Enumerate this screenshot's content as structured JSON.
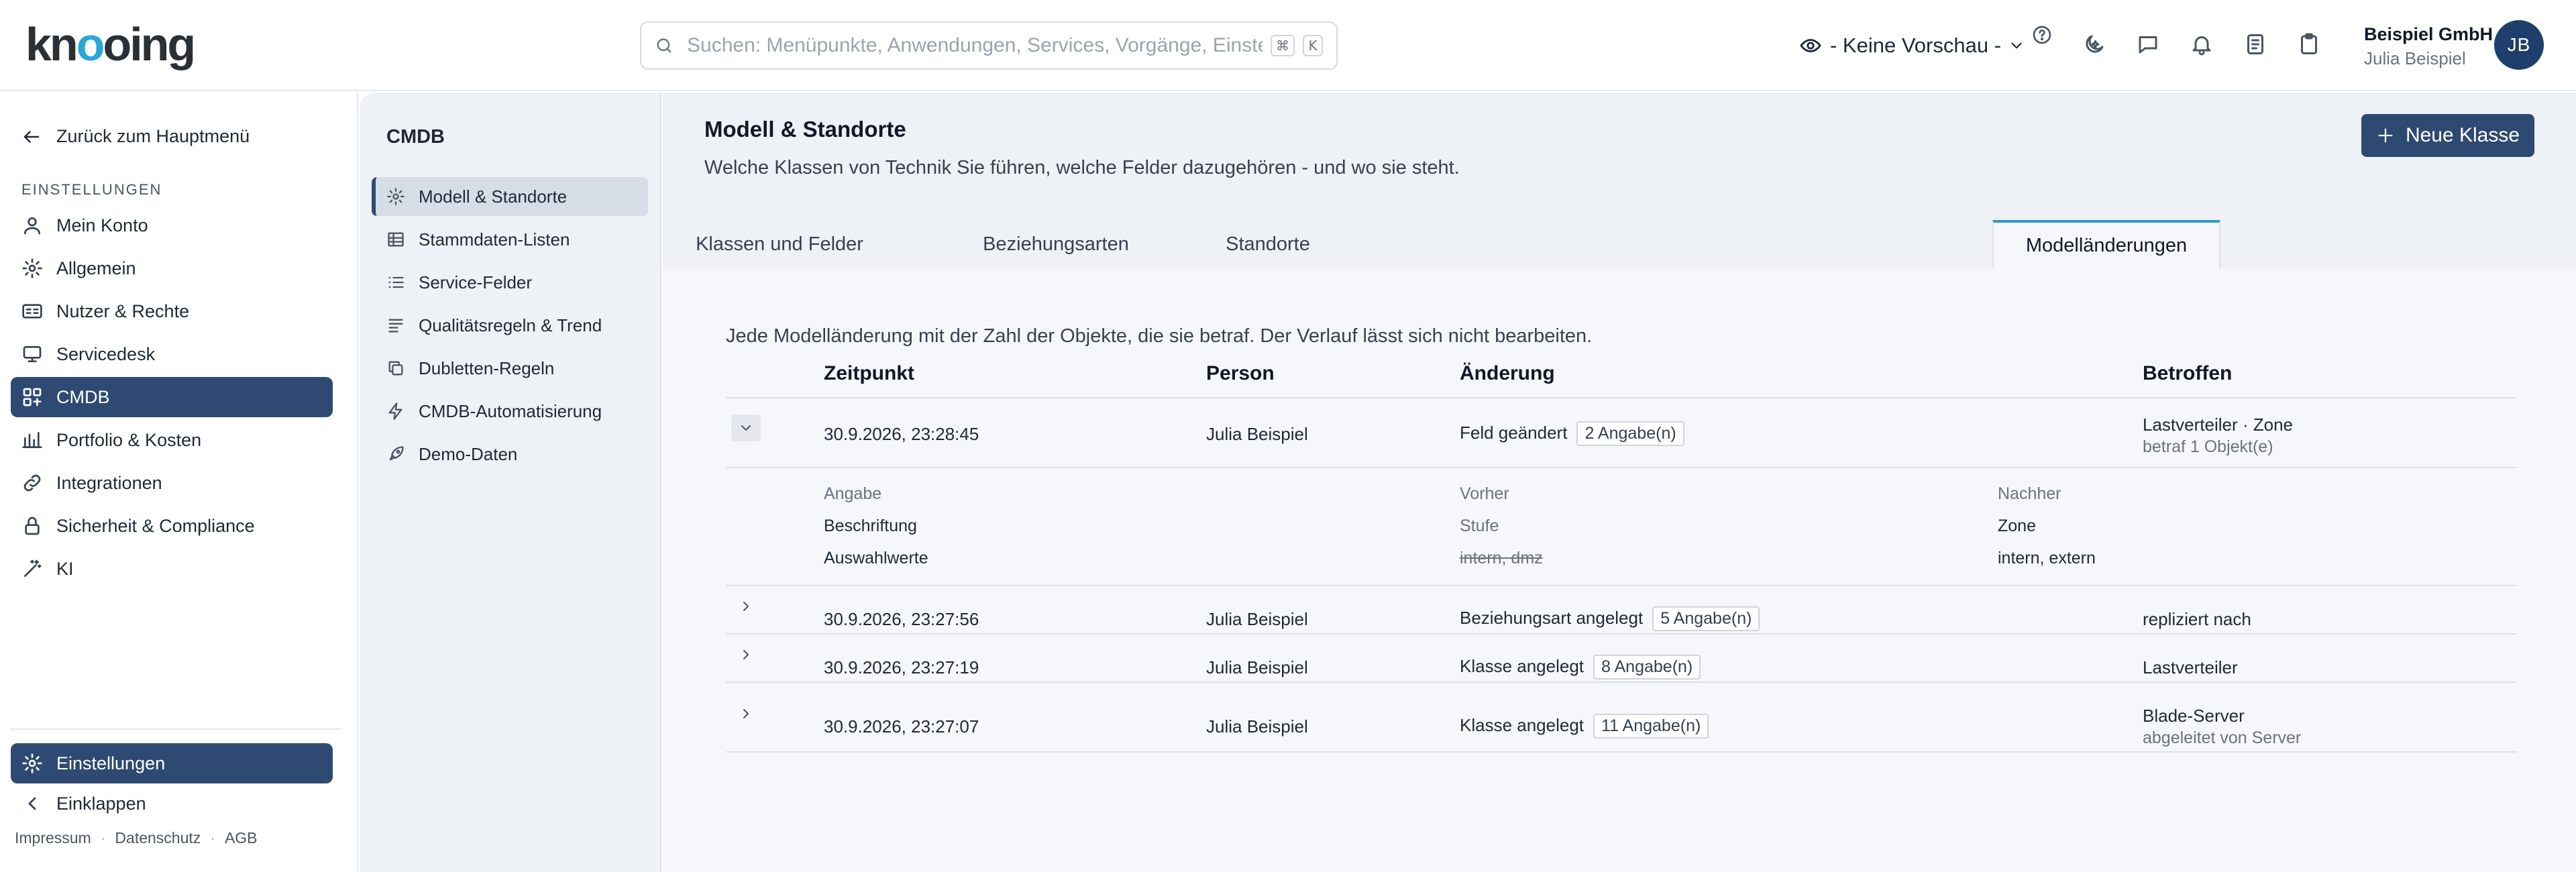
{
  "brand": {
    "logo_pre": "kn",
    "logo_o": "o",
    "logo_post": "oing"
  },
  "search": {
    "placeholder": "Suchen: Menüpunkte, Anwendungen, Services, Vorgänge, Einstellungen",
    "kbd1": "⌘",
    "kbd2": "K"
  },
  "header": {
    "preview_label": "- Keine Vorschau -",
    "company": "Beispiel GmbH",
    "user": "Julia Beispiel",
    "avatar_initials": "JB"
  },
  "leftnav": {
    "back_label": "Zurück zum Hauptmenü",
    "section_label": "EINSTELLUNGEN",
    "items": [
      {
        "label": "Mein Konto",
        "icon": "user-icon"
      },
      {
        "label": "Allgemein",
        "icon": "gear-icon"
      },
      {
        "label": "Nutzer & Rechte",
        "icon": "id-card-icon"
      },
      {
        "label": "Servicedesk",
        "icon": "monitor-icon"
      },
      {
        "label": "CMDB",
        "icon": "cmdb-icon",
        "active": true
      },
      {
        "label": "Portfolio & Kosten",
        "icon": "bar-chart-icon"
      },
      {
        "label": "Integrationen",
        "icon": "link-icon"
      },
      {
        "label": "Sicherheit & Compliance",
        "icon": "lock-icon"
      },
      {
        "label": "KI",
        "icon": "magic-wand-icon"
      }
    ],
    "settings_label": "Einstellungen",
    "collapse_label": "Einklappen",
    "footer": {
      "impressum": "Impressum",
      "datenschutz": "Datenschutz",
      "agb": "AGB",
      "sep": "·"
    }
  },
  "subnav": {
    "title": "CMDB",
    "items": [
      {
        "label": "Modell & Standorte",
        "icon": "gear-icon",
        "active": true
      },
      {
        "label": "Stammdaten-Listen",
        "icon": "table-icon"
      },
      {
        "label": "Service-Felder",
        "icon": "list-icon"
      },
      {
        "label": "Qualitätsregeln & Trend",
        "icon": "checklist-icon"
      },
      {
        "label": "Dubletten-Regeln",
        "icon": "copy-icon"
      },
      {
        "label": "CMDB-Automatisierung",
        "icon": "bolt-icon"
      },
      {
        "label": "Demo-Daten",
        "icon": "rocket-icon"
      }
    ]
  },
  "page": {
    "title": "Modell & Standorte",
    "description": "Welche Klassen von Technik Sie führen, welche Felder dazugehören - und wo sie steht.",
    "new_button": "Neue Klasse",
    "tabs": [
      "Klassen und Felder",
      "Beziehungsarten",
      "Standorte",
      "Modelländerungen"
    ],
    "active_tab": "Modelländerungen"
  },
  "changes": {
    "intro": "Jede Modelländerung mit der Zahl der Objekte, die sie betraf. Der Verlauf lässt sich nicht bearbeiten.",
    "columns": {
      "zeitpunkt": "Zeitpunkt",
      "person": "Person",
      "aenderung": "Änderung",
      "betroffen": "Betroffen"
    },
    "rows": [
      {
        "time": "30.9.2026, 23:28:45",
        "person": "Julia Beispiel",
        "change": "Feld geändert",
        "badge": "2 Angabe(n)",
        "affected": "Lastverteiler · Zone",
        "affected_sub": "betraf 1 Objekt(e)",
        "expanded": true
      },
      {
        "time": "30.9.2026, 23:27:56",
        "person": "Julia Beispiel",
        "change": "Beziehungsart angelegt",
        "badge": "5 Angabe(n)",
        "affected": "repliziert nach",
        "affected_sub": ""
      },
      {
        "time": "30.9.2026, 23:27:19",
        "person": "Julia Beispiel",
        "change": "Klasse angelegt",
        "badge": "8 Angabe(n)",
        "affected": "Lastverteiler",
        "affected_sub": ""
      },
      {
        "time": "30.9.2026, 23:27:07",
        "person": "Julia Beispiel",
        "change": "Klasse angelegt",
        "badge": "11 Angabe(n)",
        "affected": "Blade-Server",
        "affected_sub": "abgeleitet von Server"
      }
    ],
    "detail": {
      "col_field": "Angabe",
      "col_before": "Vorher",
      "col_after": "Nachher",
      "rows": [
        {
          "field": "Beschriftung",
          "before": "Stufe",
          "after": "Zone"
        },
        {
          "field": "Auswahlwerte",
          "before": "intern, dmz",
          "after": "intern, extern"
        }
      ]
    }
  },
  "colors": {
    "primary": "#2e4a72",
    "accent": "#2a9fc2",
    "logo_accent": "#2aa6d8"
  }
}
